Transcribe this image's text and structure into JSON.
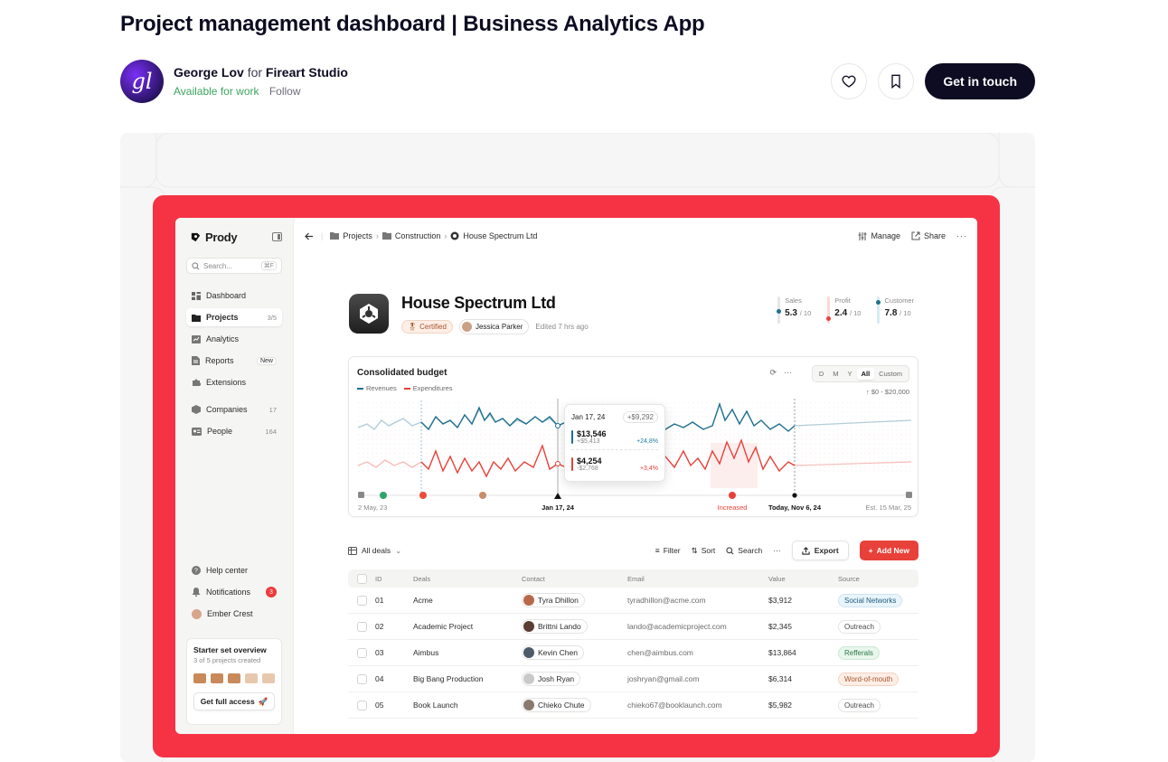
{
  "shot": {
    "title": "Project management dashboard | Business Analytics App",
    "author_name": "George Lov",
    "author_for": "for",
    "studio": "Fireart Studio",
    "availability": "Available for work",
    "follow_label": "Follow",
    "avatar_text": "gl",
    "cta_label": "Get in touch",
    "icons": [
      "heart-icon",
      "bookmark-icon"
    ]
  },
  "app": {
    "brand": "Prody",
    "search_placeholder": "Search...",
    "search_shortcut": "⌘F",
    "nav": [
      {
        "label": "Dashboard",
        "icon": "dashboard-icon",
        "count": ""
      },
      {
        "label": "Projects",
        "icon": "folder-icon",
        "count": "3/5",
        "active": true
      },
      {
        "label": "Analytics",
        "icon": "chart-icon",
        "count": ""
      },
      {
        "label": "Reports",
        "icon": "report-icon",
        "badge": "New"
      },
      {
        "label": "Extensions",
        "icon": "puzzle-icon",
        "count": ""
      },
      {
        "label": "Companies",
        "icon": "cube-icon",
        "count": "17"
      },
      {
        "label": "People",
        "icon": "id-card-icon",
        "count": "164"
      }
    ],
    "bottom_nav": {
      "help": "Help center",
      "notifications": "Notifications",
      "notifications_count": "3",
      "user": "Ember Crest"
    },
    "starter": {
      "title": "Starter set overview",
      "subtitle": "3 of 5 projects created",
      "completed": 3,
      "total": 5,
      "cta": "Get full access"
    },
    "breadcrumb": [
      "Projects",
      "Construction",
      "House Spectrum Ltd"
    ],
    "top_actions": {
      "manage": "Manage",
      "share": "Share"
    },
    "project": {
      "title": "House Spectrum Ltd",
      "certified": "Certified",
      "owner": "Jessica Parker",
      "edited": "Edited 7 hrs ago"
    },
    "kpis": [
      {
        "label": "Sales",
        "value": "5.3",
        "of": "/ 10",
        "color": "#1f6f8f"
      },
      {
        "label": "Profit",
        "value": "2.4",
        "of": "/ 10",
        "color": "#e8413a"
      },
      {
        "label": "Customer",
        "value": "7.8",
        "of": "/ 10",
        "color": "#1f6f8f"
      }
    ],
    "chart": {
      "title": "Consolidated budget",
      "legend": [
        "Revenues",
        "Expenditures"
      ],
      "ranges": [
        "D",
        "M",
        "Y",
        "All",
        "Custom"
      ],
      "selected_range": "All",
      "range_note": "↑ $0 - $20,000",
      "timeline": {
        "start": "2 May, 23",
        "mid": "Jan 17, 24",
        "alert": "Increased",
        "today": "Today, Nov 6, 24",
        "est": "Est. 15 Mar, 25"
      },
      "tooltip": {
        "date": "Jan 17, 24",
        "delta": "+$9,292",
        "rev_value": "$13,546",
        "rev_sub": "+$5,413",
        "rev_pct": "+24,8%",
        "exp_value": "$4,254",
        "exp_sub": "-$2,768",
        "exp_pct": "+3,4%"
      },
      "colors": {
        "revenue": "#1f6f8f",
        "expenditure": "#e8413a"
      }
    },
    "toolbar": {
      "view": "All deals",
      "filter": "Filter",
      "sort": "Sort",
      "search": "Search",
      "export": "Export",
      "add": "Add New"
    },
    "table": {
      "headers": [
        "ID",
        "Deals",
        "Contact",
        "Email",
        "Value",
        "Source"
      ],
      "rows": [
        {
          "id": "01",
          "deal": "Acme",
          "contact": "Tyra Dhillon",
          "email": "tyradhillon@acme.com",
          "value": "$3,912",
          "source": "Social Networks",
          "kind": "social"
        },
        {
          "id": "02",
          "deal": "Academic Project",
          "contact": "Brittni Lando",
          "email": "lando@academicproject.com",
          "value": "$2,345",
          "source": "Outreach",
          "kind": "plain"
        },
        {
          "id": "03",
          "deal": "Aimbus",
          "contact": "Kevin Chen",
          "email": "chen@aimbus.com",
          "value": "$13,864",
          "source": "Refferals",
          "kind": "ref"
        },
        {
          "id": "04",
          "deal": "Big Bang Production",
          "contact": "Josh Ryan",
          "email": "joshryan@gmail.com",
          "value": "$6,314",
          "source": "Word-of-mouth",
          "kind": "wom"
        },
        {
          "id": "05",
          "deal": "Book Launch",
          "contact": "Chieko Chute",
          "email": "chieko67@booklaunch.com",
          "value": "$5,982",
          "source": "Outreach",
          "kind": "plain"
        }
      ]
    }
  }
}
